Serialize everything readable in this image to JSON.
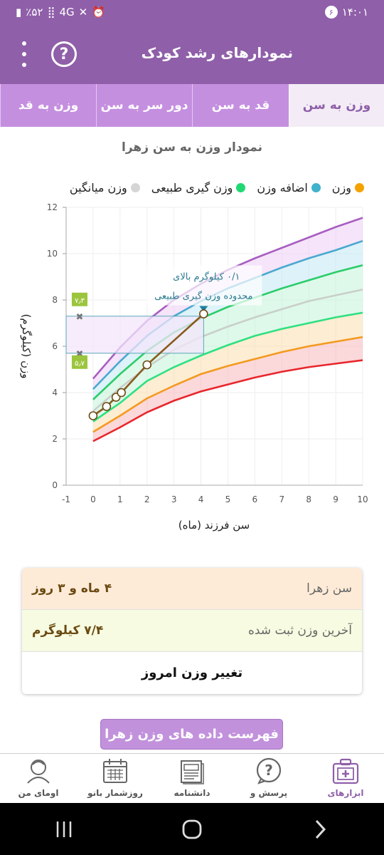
{
  "status_bar": {
    "time": "۱۴:۰۱",
    "notification_count": "۶",
    "battery": "٪۵۲",
    "network": "4G"
  },
  "app_bar": {
    "title": "نمودارهای رشد کودک"
  },
  "tabs": [
    {
      "label": "وزن به سن",
      "active": true
    },
    {
      "label": "قد به سن",
      "active": false
    },
    {
      "label": "دور سر به سن",
      "active": false
    },
    {
      "label": "وزن به قد",
      "active": false
    }
  ],
  "chart_title": "نمودار وزن به سن زهرا",
  "legend": [
    {
      "label": "وزن",
      "color": "#f5a100"
    },
    {
      "label": "اضافه وزن",
      "color": "#3fb2cd"
    },
    {
      "label": "وزن گیری طبیعی",
      "color": "#22d873"
    },
    {
      "label": "وزن میانگین",
      "color": "#d5d5d5"
    }
  ],
  "chart_data": {
    "type": "line",
    "xlabel": "سن فرزند (ماه)",
    "ylabel": "وزن (کیلوگرم)",
    "xlim": [
      -1,
      10
    ],
    "ylim": [
      0,
      12
    ],
    "x_ticks": [
      "-1",
      "0",
      "1",
      "2",
      "3",
      "4",
      "5",
      "6",
      "7",
      "8",
      "9",
      "10"
    ],
    "y_ticks": [
      "0",
      "2",
      "4",
      "6",
      "8",
      "10",
      "12"
    ],
    "reference_x": [
      0,
      1,
      2,
      3,
      4,
      5,
      6,
      7,
      8,
      9,
      10
    ],
    "curves": [
      {
        "color": "#e8262c",
        "values": [
          1.9,
          2.5,
          3.15,
          3.65,
          4.05,
          4.35,
          4.65,
          4.9,
          5.1,
          5.25,
          5.4
        ]
      },
      {
        "color": "#f39a1f",
        "values": [
          2.3,
          3.0,
          3.75,
          4.3,
          4.8,
          5.15,
          5.45,
          5.75,
          6.0,
          6.2,
          6.4
        ]
      },
      {
        "color": "#2fe080",
        "values": [
          2.75,
          3.55,
          4.5,
          5.1,
          5.6,
          6.05,
          6.45,
          6.75,
          7.0,
          7.25,
          7.45
        ]
      },
      {
        "color": "#c9cfc9",
        "values": [
          3.2,
          4.2,
          5.1,
          5.85,
          6.4,
          6.85,
          7.25,
          7.6,
          7.95,
          8.2,
          8.45
        ]
      },
      {
        "color": "#2ccd6b",
        "values": [
          3.7,
          4.8,
          5.8,
          6.6,
          7.2,
          7.7,
          8.1,
          8.5,
          8.85,
          9.2,
          9.5
        ]
      },
      {
        "color": "#4aa9cf",
        "values": [
          4.15,
          5.35,
          6.45,
          7.3,
          7.95,
          8.5,
          8.95,
          9.4,
          9.8,
          10.15,
          10.55
        ]
      },
      {
        "color": "#a85ec0",
        "values": [
          4.6,
          5.95,
          7.1,
          8.0,
          8.7,
          9.3,
          9.8,
          10.25,
          10.7,
          11.15,
          11.55
        ]
      }
    ],
    "bands": [
      {
        "from": 0,
        "to": 1,
        "color": "#f8b1b5"
      },
      {
        "from": 1,
        "to": 2,
        "color": "#fbdca8"
      },
      {
        "from": 2,
        "to": 4,
        "color": "#bdf3d5"
      },
      {
        "from": 4,
        "to": 5,
        "color": "#bde6f4"
      },
      {
        "from": 5,
        "to": 6,
        "color": "#ecc9f5"
      }
    ],
    "series": [
      {
        "name": "وزن",
        "color": "#8a5a1e",
        "x": [
          0,
          0.5,
          0.85,
          1.05,
          2.0,
          4.1
        ],
        "y": [
          3.0,
          3.4,
          3.8,
          4.0,
          5.2,
          7.4
        ]
      }
    ],
    "target_range": {
      "x_from": -1,
      "x_to": 4.1,
      "y_min": 5.7,
      "y_max": 7.3
    },
    "range_labels": {
      "max": "۷٫۳",
      "min": "۵٫۷"
    },
    "annotation": {
      "line1": "۰/۱ کیلوگرم بالای",
      "line2": "محدوده وزن گیری طبیعی",
      "x": 4.1,
      "y": 7.4
    }
  },
  "info": {
    "age_label": "سن زهرا",
    "age_value": "۴ ماه و ۳ روز",
    "weight_label": "آخرین وزن ثبت شده",
    "weight_value": "۷/۴ کیلوگرم",
    "action_label": "تغییر وزن امروز"
  },
  "list_button": "فهرست داده های وزن زهرا",
  "bottom_nav": [
    {
      "label": "ابزارهای",
      "icon": "toolkit-icon",
      "active": true
    },
    {
      "label": "پرسش و",
      "icon": "question-icon",
      "active": false
    },
    {
      "label": "دانشنامه",
      "icon": "encyclopedia-icon",
      "active": false
    },
    {
      "label": "روزشمار بانو",
      "icon": "calendar-icon",
      "active": false
    },
    {
      "label": "اومای من",
      "icon": "profile-icon",
      "active": false
    }
  ],
  "colors": {
    "primary": "#8f5fa9",
    "tab_bar": "#c58fe0",
    "button": "#c291dc"
  }
}
